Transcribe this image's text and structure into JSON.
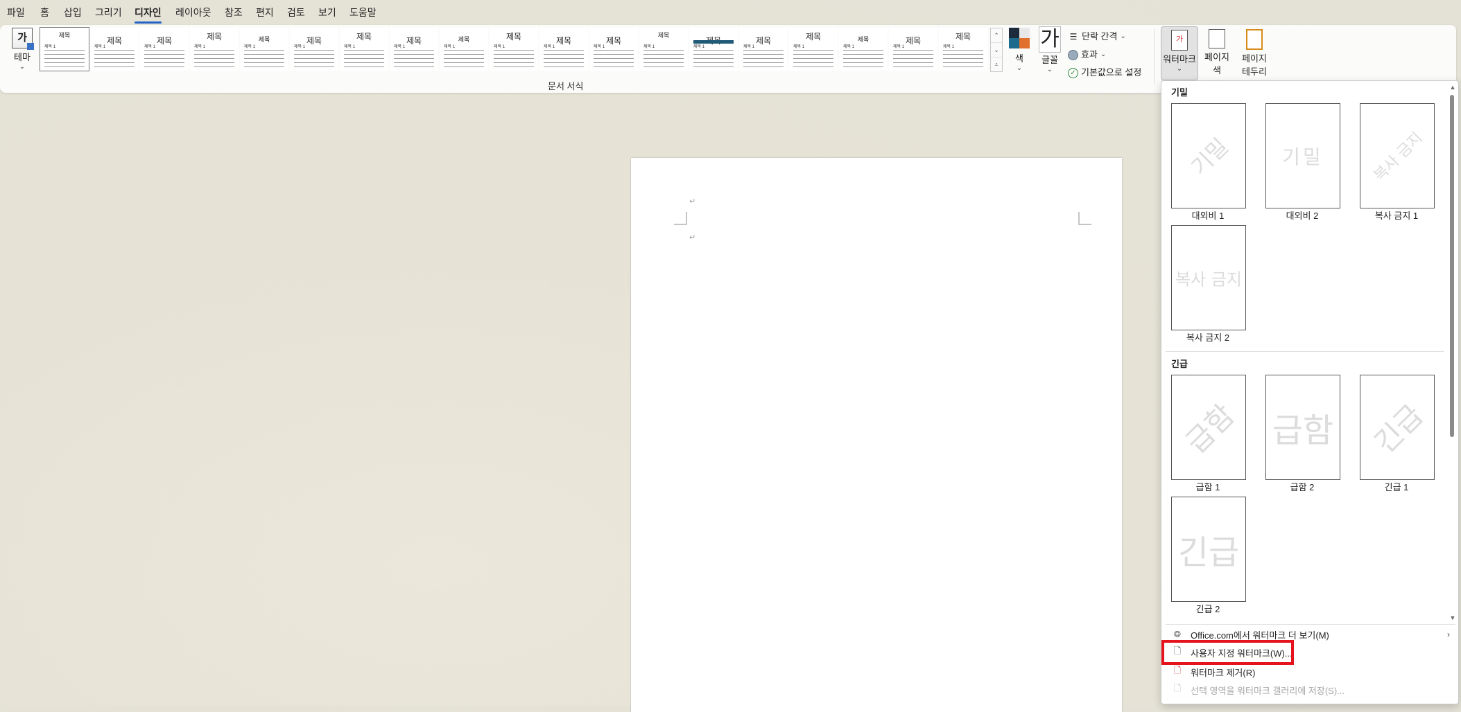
{
  "menu": {
    "tabs": [
      "파일",
      "홈",
      "삽입",
      "그리기",
      "디자인",
      "레이아웃",
      "참조",
      "편지",
      "검토",
      "보기",
      "도움말"
    ],
    "active_tab": "디자인"
  },
  "ribbon": {
    "theme_label": "테마",
    "theme_glyph": "가",
    "style_thumb_title": "제목",
    "style_thumb_heading": "제목 1",
    "group_label": "문서 서식",
    "color_label": "색",
    "font_label": "글꼴",
    "font_glyph": "가",
    "paragraph_spacing": "단락 간격",
    "effects": "효과",
    "set_default": "기본값으로 설정",
    "watermark_label": "워터마크",
    "watermark_glyph": "가",
    "page_color_label": "페이지 색",
    "page_border_label_1": "페이지",
    "page_border_label_2": "테두리",
    "theme_colors": [
      "#1b2b3b",
      "#e8e8e8",
      "#1c6a8c",
      "#e0702c"
    ]
  },
  "document": {
    "paragraph_mark": "↵"
  },
  "watermark_menu": {
    "section_confidential": "기밀",
    "section_urgent": "긴급",
    "items_confidential": [
      {
        "caption": "대외비 1",
        "text": "기밀"
      },
      {
        "caption": "대외비 2",
        "text": "기밀"
      },
      {
        "caption": "복사 금지 1",
        "text": "복사 금지"
      },
      {
        "caption": "복사 금지 2",
        "text": "복사 금지"
      }
    ],
    "items_urgent": [
      {
        "caption": "급함 1",
        "text": "급함"
      },
      {
        "caption": "급함 2",
        "text": "급함"
      },
      {
        "caption": "긴급 1",
        "text": "긴급"
      },
      {
        "caption": "긴급 2",
        "text": "긴급"
      }
    ],
    "more_online": "Office.com에서 워터마크 더 보기(M)",
    "custom_watermark": "사용자 지정 워터마크(W)...",
    "remove_watermark": "워터마크 제거(R)",
    "save_selection": "선택 영역을 워터마크 갤러리에 저장(S)...",
    "highlight_color": "#e5141c"
  }
}
